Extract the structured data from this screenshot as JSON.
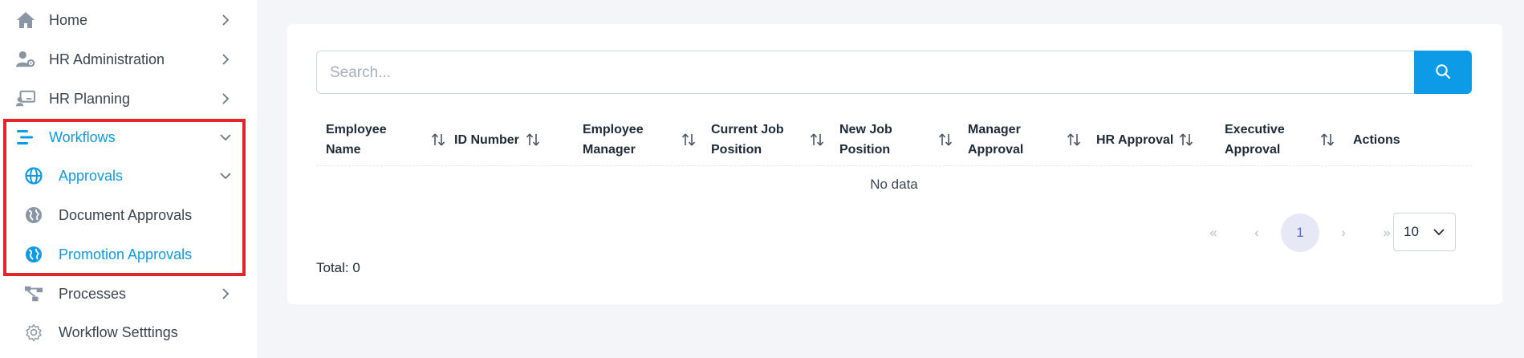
{
  "sidebar": {
    "items": [
      {
        "label": "Home",
        "icon": "home-icon"
      },
      {
        "label": "HR Administration",
        "icon": "user-gear-icon"
      },
      {
        "label": "HR Planning",
        "icon": "presentation-icon"
      },
      {
        "label": "Workflows",
        "icon": "workflow-list-icon",
        "state": "expanded-active"
      },
      {
        "label": "Approvals",
        "icon": "globe-icon",
        "state": "expanded-active"
      },
      {
        "label": "Document Approvals",
        "icon": "globe-icon"
      },
      {
        "label": "Promotion Approvals",
        "icon": "globe-icon",
        "state": "selected"
      },
      {
        "label": "Processes",
        "icon": "process-flow-icon"
      },
      {
        "label": "Workflow Setttings",
        "icon": "gear-icon"
      }
    ],
    "highlight_color": "#e3242b"
  },
  "search": {
    "placeholder": "Search...",
    "value": "",
    "button_icon": "search-icon"
  },
  "table": {
    "columns": [
      "Employee Name",
      "ID Number",
      "Employee Manager",
      "Current Job Position",
      "New Job Position",
      "Manager Approval",
      "HR Approval",
      "Executive Approval",
      "Actions"
    ],
    "empty_text": "No data",
    "rows": []
  },
  "pagination": {
    "first": "«",
    "prev": "‹",
    "current_page": "1",
    "next": "›",
    "last": "»",
    "page_size": "10"
  },
  "footer": {
    "total_text": "Total: 0"
  },
  "colors": {
    "accent": "#0d9ae6",
    "background": "#f3f5f8",
    "active_page_bg": "#e6e9f5"
  }
}
